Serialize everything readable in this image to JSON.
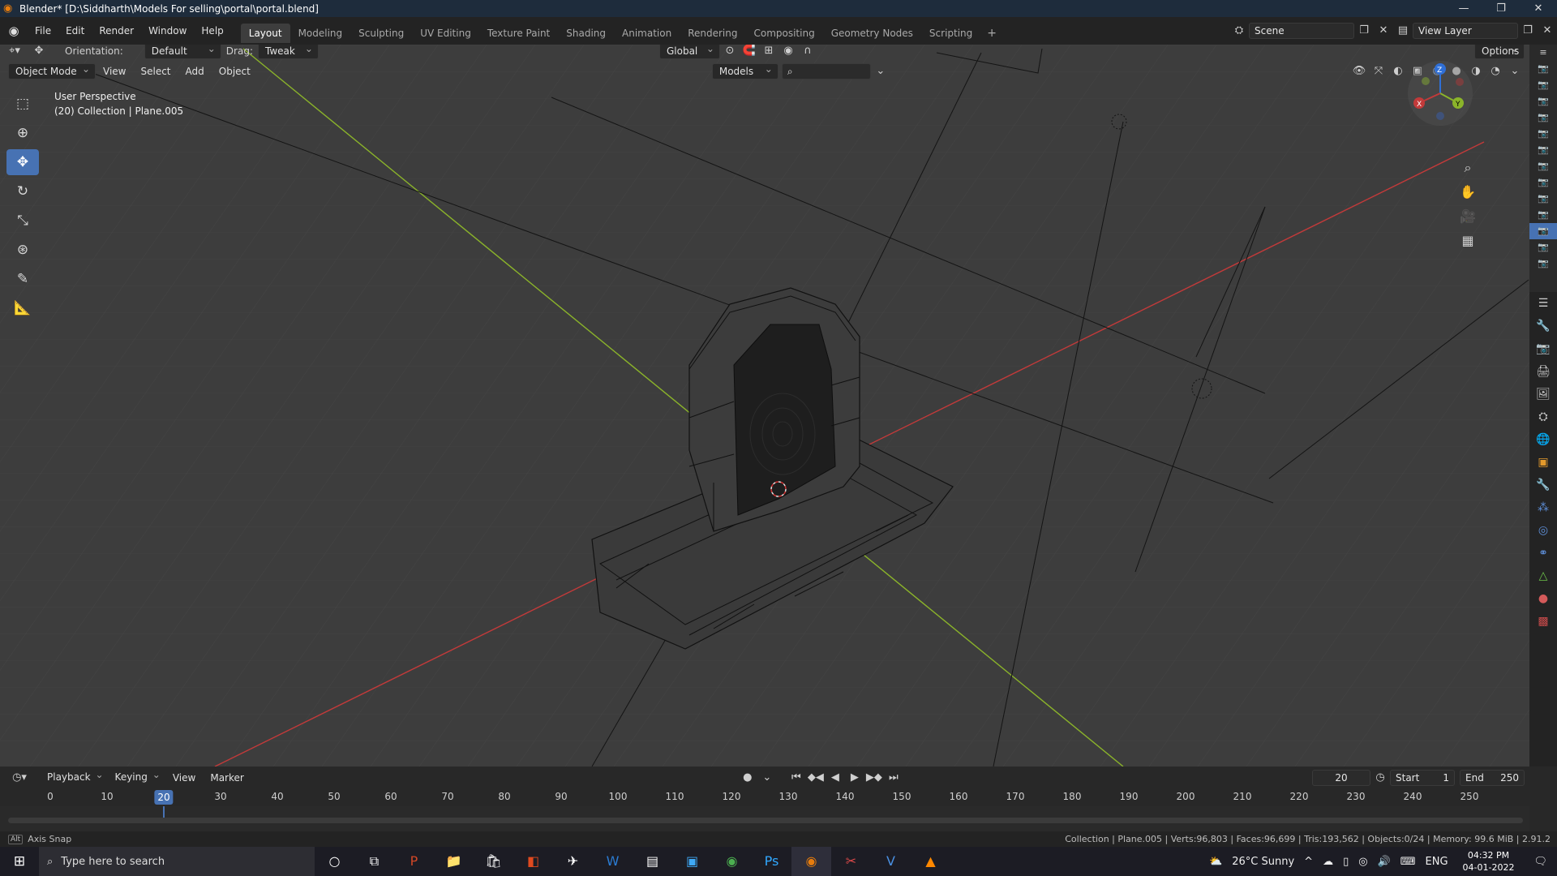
{
  "window": {
    "title": "Blender* [D:\\Siddharth\\Models For selling\\portal\\portal.blend]"
  },
  "menu": {
    "items": [
      "File",
      "Edit",
      "Render",
      "Window",
      "Help"
    ]
  },
  "workspaces": [
    "Layout",
    "Modeling",
    "Sculpting",
    "UV Editing",
    "Texture Paint",
    "Shading",
    "Animation",
    "Rendering",
    "Compositing",
    "Geometry Nodes",
    "Scripting"
  ],
  "active_workspace": "Layout",
  "scene": {
    "name": "Scene",
    "view_layer": "View Layer"
  },
  "tool_header": {
    "orientation_label": "Orientation:",
    "orientation_value": "Default",
    "drag_label": "Drag:",
    "drag_value": "Tweak",
    "transform_orientation": "Global",
    "options_label": "Options"
  },
  "viewport_header": {
    "mode": "Object Mode",
    "menus": [
      "View",
      "Select",
      "Add",
      "Object"
    ],
    "collection_filter": "Models"
  },
  "viewport": {
    "perspective": "User Perspective",
    "context": "(20) Collection | Plane.005"
  },
  "tools": [
    "select-box",
    "cursor",
    "move",
    "rotate",
    "scale",
    "transform",
    "annotate",
    "measure"
  ],
  "active_tool": "move",
  "timeline": {
    "menus": [
      "Playback",
      "Keying",
      "View",
      "Marker"
    ],
    "current_frame": "20",
    "start_label": "Start",
    "start": "1",
    "end_label": "End",
    "end": "250",
    "ruler": [
      0,
      10,
      20,
      30,
      40,
      50,
      60,
      70,
      80,
      90,
      100,
      110,
      120,
      130,
      140,
      150,
      160,
      170,
      180,
      190,
      200,
      210,
      220,
      230,
      240,
      250
    ]
  },
  "status": {
    "left": "Axis Snap",
    "right": "Collection | Plane.005 | Verts:96,803 | Faces:96,699 | Tris:193,562 | Objects:0/24 | Memory: 99.6 MiB | 2.91.2"
  },
  "taskbar": {
    "search_placeholder": "Type here to search",
    "weather": "26°C Sunny",
    "language": "ENG",
    "time": "04:32 PM",
    "date": "04-01-2022"
  },
  "colors": {
    "x_axis": "#c23a3a",
    "y_axis": "#8bb42a",
    "accent": "#4772b3",
    "viewport_bg": "#3d3d3d"
  }
}
